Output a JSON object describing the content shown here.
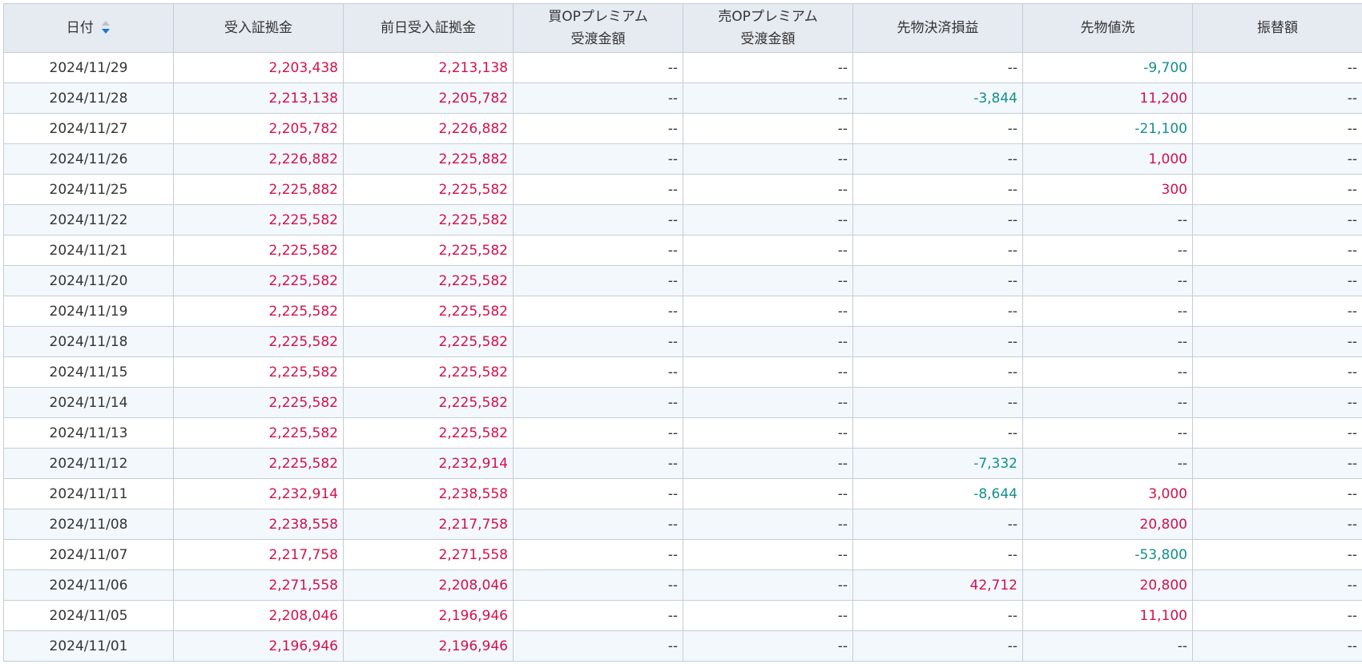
{
  "table": {
    "headers": {
      "date": "日付",
      "margin": "受入証拠金",
      "prev_margin": "前日受入証拠金",
      "buy_op_line1": "買OPプレミアム",
      "buy_op_line2": "受渡金額",
      "sell_op_line1": "売OPプレミアム",
      "sell_op_line2": "受渡金額",
      "futures_pl": "先物決済損益",
      "futures_mtm": "先物値洗",
      "transfer": "振替額"
    },
    "sort": {
      "column": "date",
      "direction": "desc"
    },
    "colors": {
      "positive": "#d3114a",
      "negative": "#12908b",
      "header_bg": "#e6eaf1",
      "stripe_bg": "#f3f8fc"
    },
    "rows": [
      [
        "2024/11/29",
        "2,203,438",
        "2,213,138",
        "--",
        "--",
        "--",
        "-9,700",
        "--"
      ],
      [
        "2024/11/28",
        "2,213,138",
        "2,205,782",
        "--",
        "--",
        "-3,844",
        "11,200",
        "--"
      ],
      [
        "2024/11/27",
        "2,205,782",
        "2,226,882",
        "--",
        "--",
        "--",
        "-21,100",
        "--"
      ],
      [
        "2024/11/26",
        "2,226,882",
        "2,225,882",
        "--",
        "--",
        "--",
        "1,000",
        "--"
      ],
      [
        "2024/11/25",
        "2,225,882",
        "2,225,582",
        "--",
        "--",
        "--",
        "300",
        "--"
      ],
      [
        "2024/11/22",
        "2,225,582",
        "2,225,582",
        "--",
        "--",
        "--",
        "--",
        "--"
      ],
      [
        "2024/11/21",
        "2,225,582",
        "2,225,582",
        "--",
        "--",
        "--",
        "--",
        "--"
      ],
      [
        "2024/11/20",
        "2,225,582",
        "2,225,582",
        "--",
        "--",
        "--",
        "--",
        "--"
      ],
      [
        "2024/11/19",
        "2,225,582",
        "2,225,582",
        "--",
        "--",
        "--",
        "--",
        "--"
      ],
      [
        "2024/11/18",
        "2,225,582",
        "2,225,582",
        "--",
        "--",
        "--",
        "--",
        "--"
      ],
      [
        "2024/11/15",
        "2,225,582",
        "2,225,582",
        "--",
        "--",
        "--",
        "--",
        "--"
      ],
      [
        "2024/11/14",
        "2,225,582",
        "2,225,582",
        "--",
        "--",
        "--",
        "--",
        "--"
      ],
      [
        "2024/11/13",
        "2,225,582",
        "2,225,582",
        "--",
        "--",
        "--",
        "--",
        "--"
      ],
      [
        "2024/11/12",
        "2,225,582",
        "2,232,914",
        "--",
        "--",
        "-7,332",
        "--",
        "--"
      ],
      [
        "2024/11/11",
        "2,232,914",
        "2,238,558",
        "--",
        "--",
        "-8,644",
        "3,000",
        "--"
      ],
      [
        "2024/11/08",
        "2,238,558",
        "2,217,758",
        "--",
        "--",
        "--",
        "20,800",
        "--"
      ],
      [
        "2024/11/07",
        "2,217,758",
        "2,271,558",
        "--",
        "--",
        "--",
        "-53,800",
        "--"
      ],
      [
        "2024/11/06",
        "2,271,558",
        "2,208,046",
        "--",
        "--",
        "42,712",
        "20,800",
        "--"
      ],
      [
        "2024/11/05",
        "2,208,046",
        "2,196,946",
        "--",
        "--",
        "--",
        "11,100",
        "--"
      ],
      [
        "2024/11/01",
        "2,196,946",
        "2,196,946",
        "--",
        "--",
        "--",
        "--",
        "--"
      ]
    ]
  }
}
